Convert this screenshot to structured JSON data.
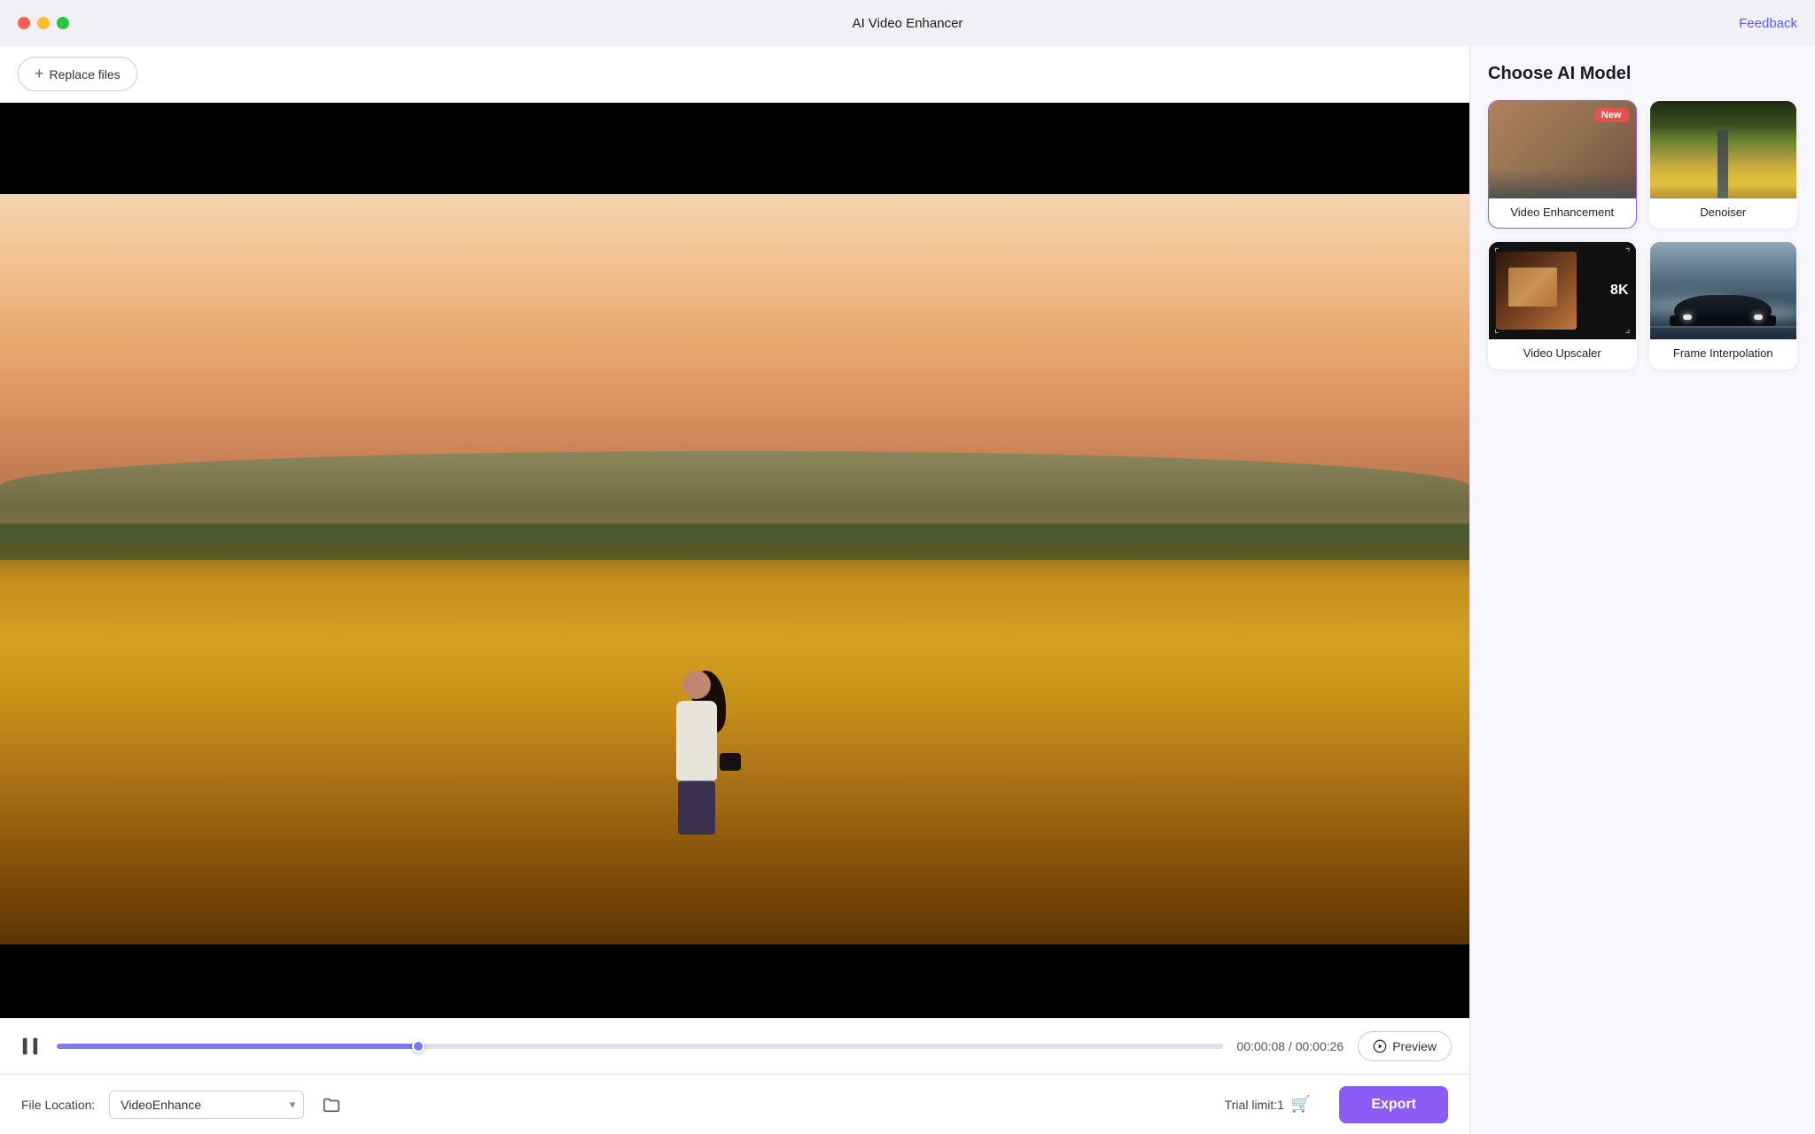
{
  "titleBar": {
    "title": "AI Video Enhancer",
    "feedbackLabel": "Feedback"
  },
  "toolbar": {
    "replaceFilesLabel": "Replace files"
  },
  "videoPlayer": {
    "currentTime": "00:00:08",
    "totalTime": "00:00:26",
    "timeSeparator": "/",
    "previewLabel": "Preview",
    "progressPercent": 31
  },
  "bottomBar": {
    "fileLocationLabel": "File Location:",
    "fileLocationValue": "VideoEnhance",
    "trialLimitLabel": "Trial limit:1",
    "exportLabel": "Export"
  },
  "rightPanel": {
    "title": "Choose AI Model",
    "models": [
      {
        "id": "video-enhancement",
        "label": "Video Enhancement",
        "isNew": true,
        "newBadge": "New"
      },
      {
        "id": "denoiser",
        "label": "Denoiser",
        "isNew": false
      },
      {
        "id": "video-upscaler",
        "label": "Video Upscaler",
        "isNew": false,
        "badge": "8K"
      },
      {
        "id": "frame-interpolation",
        "label": "Frame Interpolation",
        "isNew": false
      }
    ]
  }
}
